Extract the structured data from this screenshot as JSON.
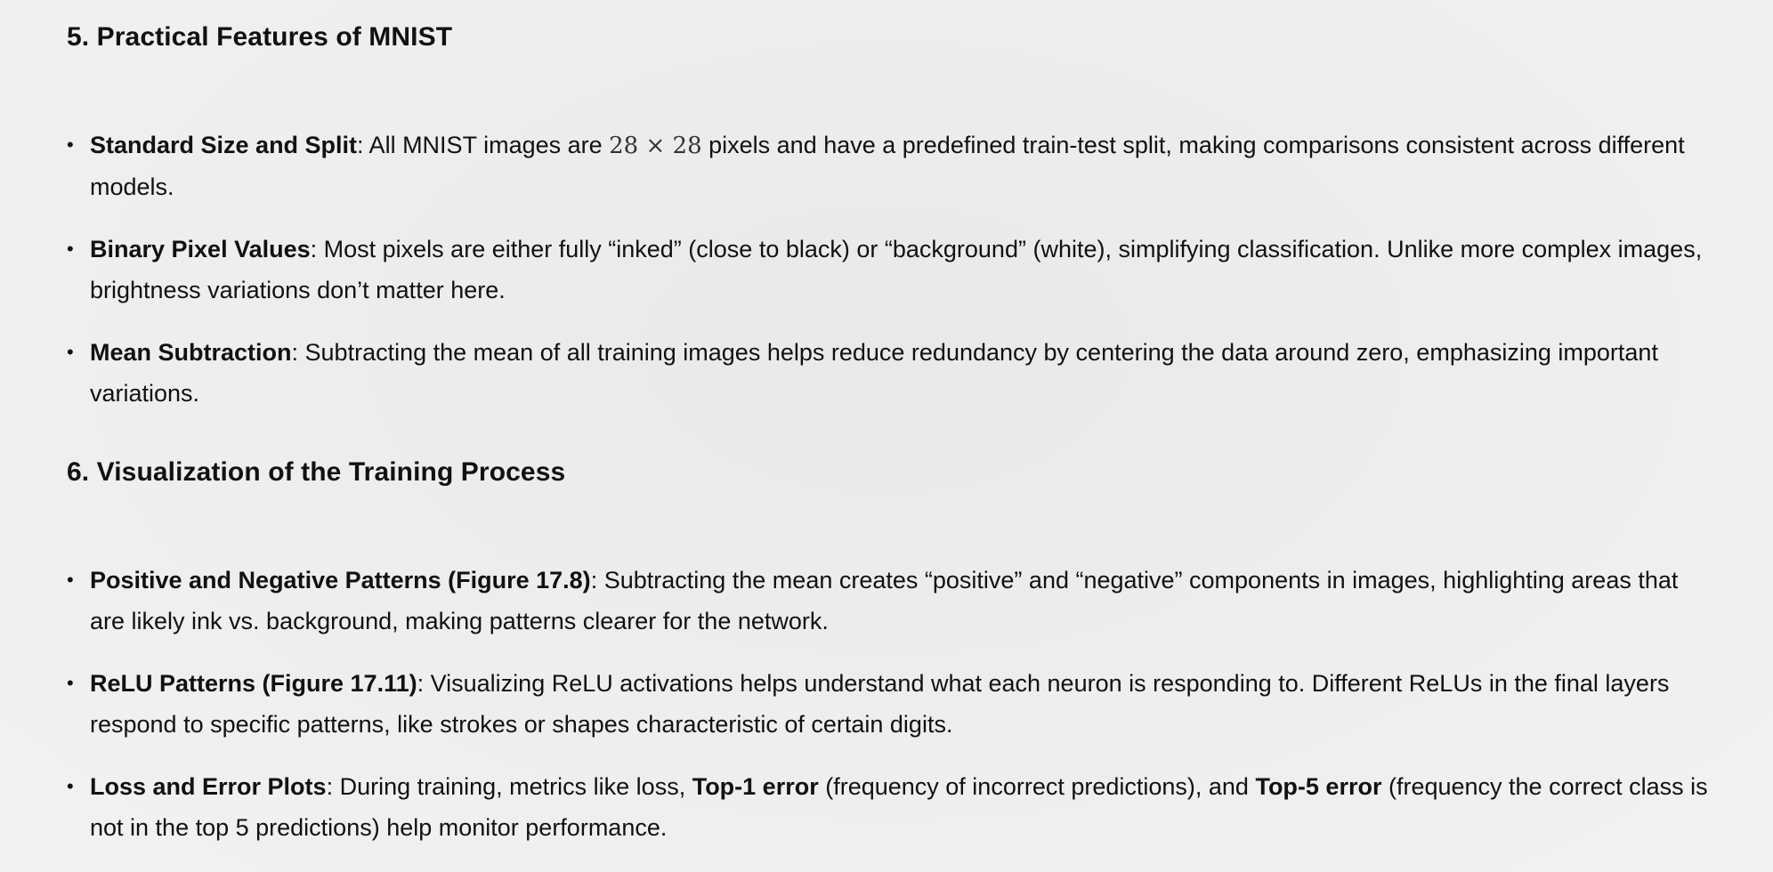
{
  "sections": [
    {
      "title": "5. Practical Features of MNIST",
      "items": [
        {
          "term": "Standard Size and Split",
          "before_math": ": All MNIST images are ",
          "math": "28 × 28",
          "after_math": " pixels and have a predefined train-test split, making comparisons consistent across different models."
        },
        {
          "term": "Binary Pixel Values",
          "text": ": Most pixels are either fully “inked” (close to black) or “background” (white), simplifying classification. Unlike more complex images, brightness variations don’t matter here."
        },
        {
          "term": "Mean Subtraction",
          "text": ": Subtracting the mean of all training images helps reduce redundancy by centering the data around zero, emphasizing important variations."
        }
      ]
    },
    {
      "title": "6. Visualization of the Training Process",
      "items": [
        {
          "term": "Positive and Negative Patterns (Figure 17.8)",
          "text": ": Subtracting the mean creates “positive” and “negative” components in images, highlighting areas that are likely ink vs. background, making patterns clearer for the network."
        },
        {
          "term": "ReLU Patterns (Figure 17.11)",
          "text": ": Visualizing ReLU activations helps understand what each neuron is responding to. Different ReLUs in the final layers respond to specific patterns, like strokes or shapes characteristic of certain digits."
        },
        {
          "term": "Loss and Error Plots",
          "text_1": ": During training, metrics like loss, ",
          "term_2": "Top-1 error",
          "text_2": " (frequency of incorrect predictions), and ",
          "term_3": "Top-5 error",
          "text_3": " (frequency the correct class is not in the top 5 predictions) help monitor performance."
        }
      ]
    }
  ]
}
